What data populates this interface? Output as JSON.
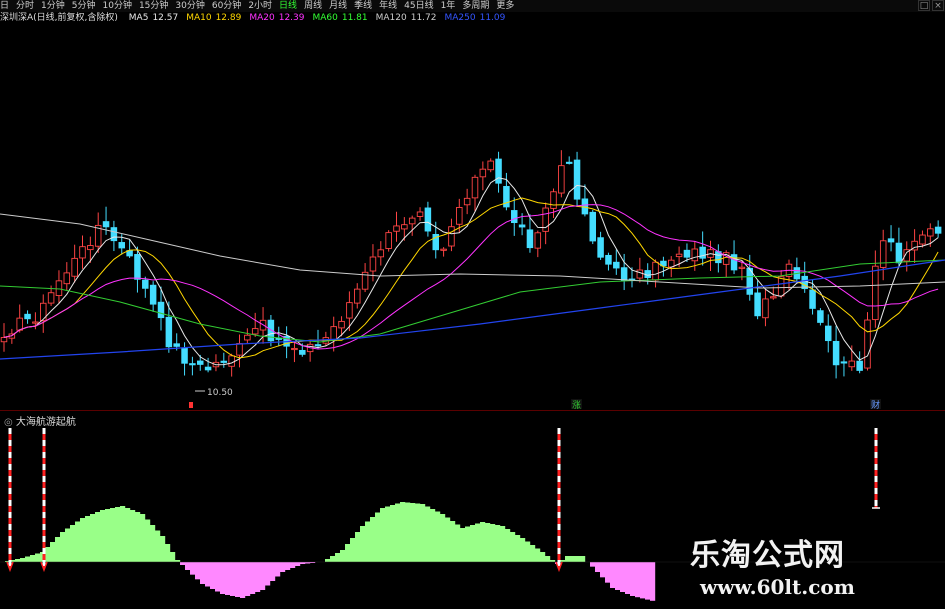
{
  "toolbar": {
    "items": [
      "日",
      "分时",
      "1分钟",
      "5分钟",
      "10分钟",
      "15分钟",
      "30分钟",
      "60分钟",
      "2小时",
      "日线",
      "周线",
      "月线",
      "季线",
      "年线",
      "45日线",
      "1年",
      "多周期",
      "更多"
    ],
    "active_index": 9,
    "win_buttons": [
      "□",
      "×"
    ]
  },
  "ma_legend": {
    "prefix": "深圳深A(日线,前复权,含除权)",
    "items": [
      {
        "label": "MA5",
        "value": "12.57",
        "color": "#e8e8e8"
      },
      {
        "label": "MA10",
        "value": "12.89",
        "color": "#ffd700"
      },
      {
        "label": "MA20",
        "value": "12.39",
        "color": "#ff33ff"
      },
      {
        "label": "MA60",
        "value": "11.81",
        "color": "#33ff33"
      },
      {
        "label": "MA120",
        "value": "11.72",
        "color": "#cccccc"
      },
      {
        "label": "MA250",
        "value": "11.09",
        "color": "#3355ff"
      }
    ]
  },
  "main_chart": {
    "low_label": "10.50",
    "markers": [
      {
        "text": "涨",
        "color": "#33cc33"
      },
      {
        "text": "财",
        "color": "#6699ff"
      }
    ]
  },
  "indicator": {
    "title": "大海航游起航",
    "colors": {
      "positive": "#99ff88",
      "negative": "#ff88ff"
    }
  },
  "watermark": {
    "name": "乐淘公式网",
    "url": "www.60lt.com"
  }
}
